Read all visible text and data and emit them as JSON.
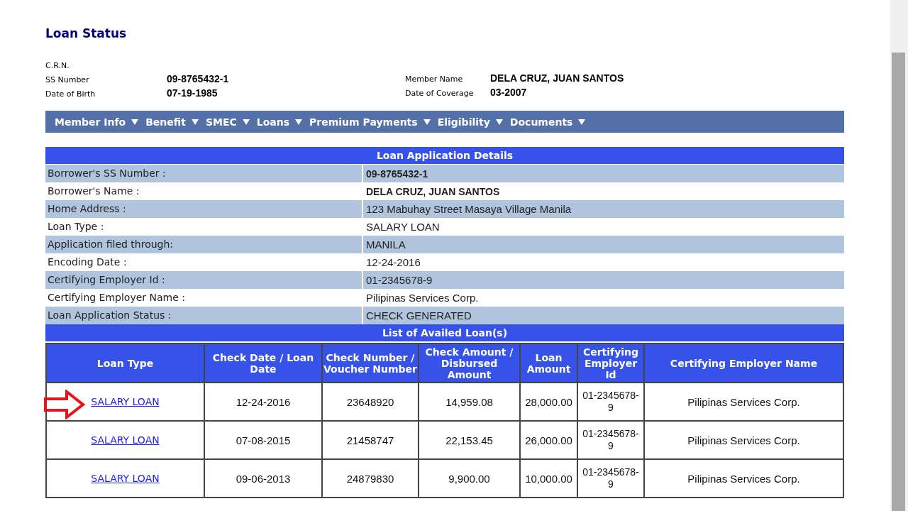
{
  "page_title": "Loan Status",
  "member_fields": [
    {
      "label": "C.R.N."
    },
    {
      "label": "SS Number",
      "value": "09-8765432-1"
    },
    {
      "label": "Date of Birth",
      "value": "07-19-1985"
    }
  ],
  "member_fields_right": [
    {
      "label": "Member Name",
      "value": "DELA CRUZ, JUAN SANTOS"
    },
    {
      "label": "Date of Coverage",
      "value": "03-2007"
    }
  ],
  "menu": [
    {
      "label": "Member Info"
    },
    {
      "label": "Benefit"
    },
    {
      "label": "SMEC"
    },
    {
      "label": "Loans"
    },
    {
      "label": "Premium Payments"
    },
    {
      "label": "Eligibility"
    },
    {
      "label": "Documents"
    }
  ],
  "details": {
    "title": "Loan Application Details",
    "rows": [
      {
        "label": "Borrower's SS Number :",
        "value": "09-8765432-1",
        "bold": true
      },
      {
        "label": "Borrower's Name :",
        "value": "DELA CRUZ, JUAN SANTOS",
        "bold": true
      },
      {
        "label": "Home Address :",
        "value": "123 Mabuhay Street Masaya Village Manila",
        "bold": false
      },
      {
        "label": "Loan Type :",
        "value": "SALARY LOAN",
        "bold": false
      },
      {
        "label": "Application filed through:",
        "value": "MANILA",
        "bold": false
      },
      {
        "label": "Encoding Date :",
        "value": "12-24-2016",
        "bold": false
      },
      {
        "label": "Certifying Employer Id :",
        "value": "01-2345678-9",
        "bold": false
      },
      {
        "label": "Certifying Employer Name :",
        "value": "Pilipinas Services Corp.",
        "bold": false
      },
      {
        "label": "Loan Application Status :",
        "value": "CHECK GENERATED",
        "bold": false
      }
    ]
  },
  "loans": {
    "title": "List of Availed Loan(s)",
    "columns": [
      "Loan Type",
      "Check Date / Loan Date",
      "Check Number / Voucher Number",
      "Check Amount / Disbursed Amount",
      "Loan Amount",
      "Certifying Employer Id",
      "Certifying Employer Name"
    ],
    "rows": [
      {
        "pointed": true,
        "cells": [
          "SALARY LOAN",
          "12-24-2016",
          "23648920",
          "14,959.08",
          "28,000.00",
          "01-2345678-9",
          "Pilipinas Services Corp."
        ]
      },
      {
        "pointed": false,
        "cells": [
          "SALARY LOAN",
          "07-08-2015",
          "21458747",
          "22,153.45",
          "26,000.00",
          "01-2345678-9",
          "Pilipinas Services Corp."
        ]
      },
      {
        "pointed": false,
        "cells": [
          "SALARY LOAN",
          "09-06-2013",
          "24879830",
          "9,900.00",
          "10,000.00",
          "01-2345678-9",
          "Pilipinas Services Corp."
        ]
      }
    ]
  }
}
